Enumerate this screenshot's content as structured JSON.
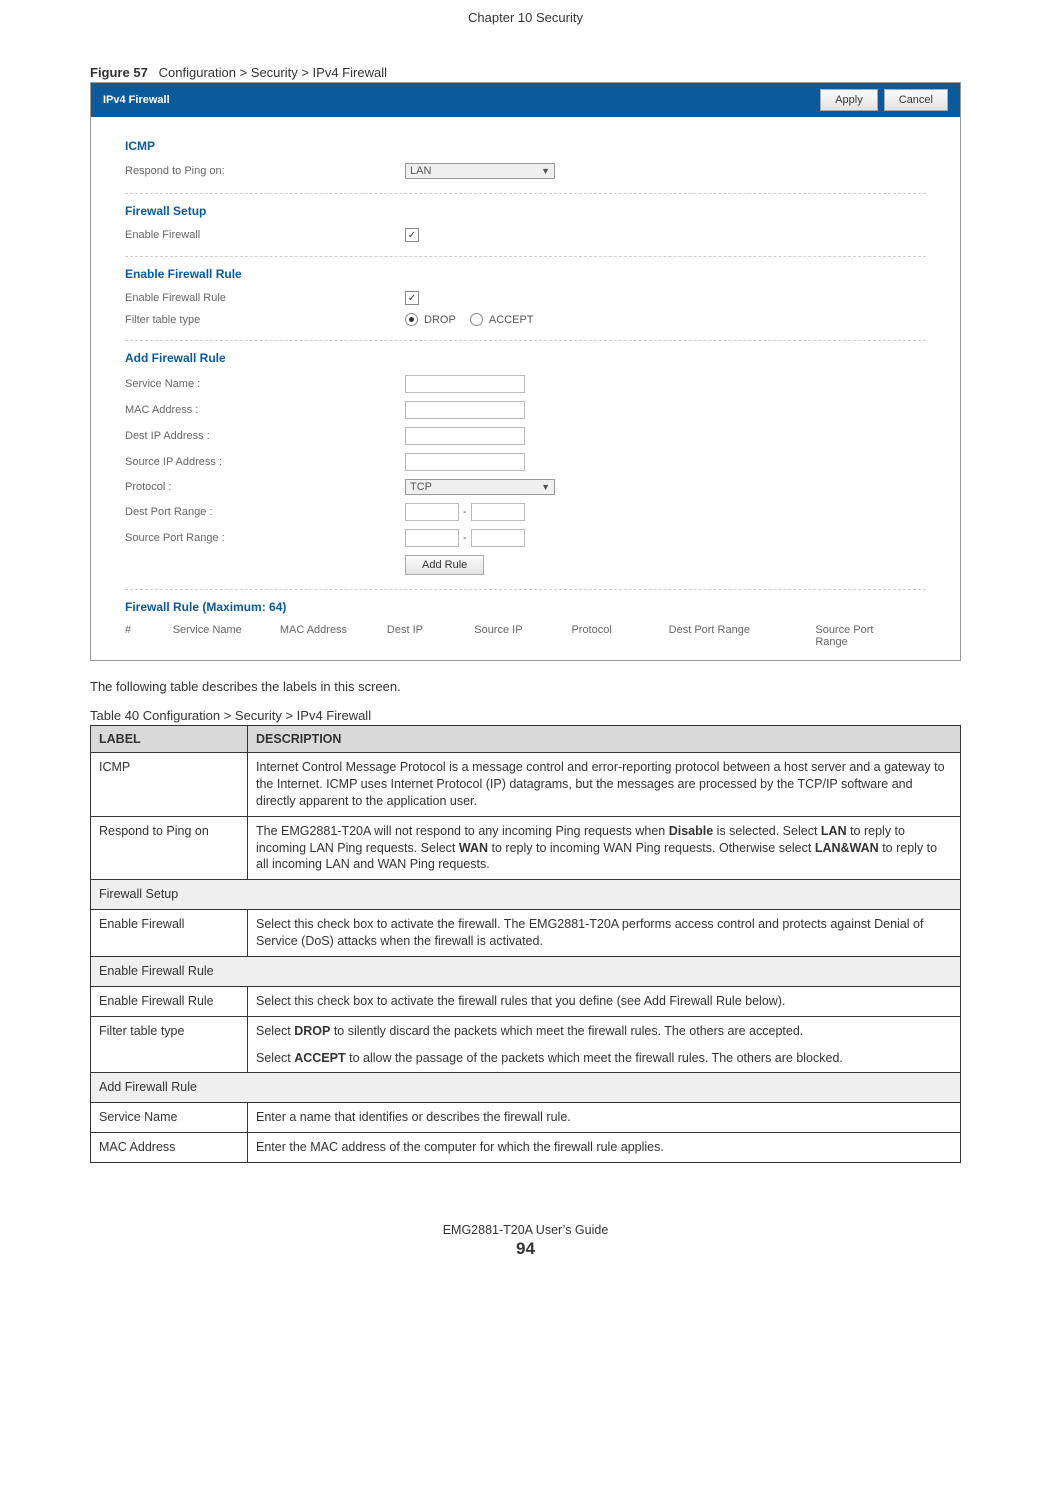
{
  "header": {
    "chapter": "Chapter 10 Security"
  },
  "figure": {
    "label": "Figure 57",
    "caption": "Configuration > Security > IPv4 Firewall"
  },
  "screenshot": {
    "title": "IPv4 Firewall",
    "apply": "Apply",
    "cancel": "Cancel",
    "sections": {
      "icmp": {
        "title": "ICMP",
        "respond_label": "Respond to Ping on:",
        "respond_value": "LAN"
      },
      "fw_setup": {
        "title": "Firewall Setup",
        "enable_label": "Enable Firewall"
      },
      "fw_rule": {
        "title": "Enable Firewall Rule",
        "enable_label": "Enable Firewall Rule",
        "filter_label": "Filter table type",
        "drop": "DROP",
        "accept": "ACCEPT"
      },
      "add_rule": {
        "title": "Add Firewall Rule",
        "service": "Service Name :",
        "mac": "MAC Address :",
        "destip": "Dest IP Address :",
        "srcip": "Source IP Address :",
        "proto_label": "Protocol :",
        "proto_value": "TCP",
        "destport": "Dest Port Range :",
        "srcport": "Source Port Range :",
        "add_btn": "Add Rule"
      },
      "rule_list": {
        "title": "Firewall Rule (Maximum: 64)",
        "cols": {
          "num": "#",
          "service": "Service Name",
          "mac": "MAC Address",
          "destip": "Dest IP",
          "srcip": "Source IP",
          "proto": "Protocol",
          "destport": "Dest Port Range",
          "srcport": "Source Port Range"
        }
      }
    }
  },
  "intro_text": "The following table describes the labels in this screen.",
  "table": {
    "caption": "Table 40   Configuration > Security > IPv4 Firewall",
    "head": {
      "label": "LABEL",
      "desc": "DESCRIPTION"
    },
    "rows": {
      "icmp": {
        "label": "ICMP",
        "desc": "Internet Control Message Protocol is a message control and error-reporting protocol between a host server and a gateway to the Internet. ICMP uses Internet Protocol (IP) datagrams, but the messages are processed by the TCP/IP software and directly apparent to the application user."
      },
      "respond": {
        "label": "Respond to Ping on",
        "p1a": "The EMG2881-T20A will not respond to any incoming Ping requests when ",
        "p1b": "Disable",
        "p1c": " is selected. Select ",
        "p1d": "LAN",
        "p1e": " to reply to incoming LAN Ping requests. Select ",
        "p1f": "WAN",
        "p1g": " to reply to incoming WAN Ping requests. Otherwise select ",
        "p1h": "LAN&WAN",
        "p1i": " to reply to all incoming LAN and WAN Ping requests."
      },
      "fw_setup_section": {
        "label": "Firewall Setup"
      },
      "enable_fw": {
        "label": "Enable Firewall",
        "desc": "Select this check box to activate the firewall. The EMG2881-T20A performs access control and protects against Denial of Service (DoS) attacks when the firewall is activated."
      },
      "fw_rule_section": {
        "label": "Enable Firewall Rule"
      },
      "enable_fw_rule": {
        "label": "Enable Firewall Rule",
        "desc": "Select this check box to activate the firewall rules that you define (see Add Firewall Rule below)."
      },
      "filter_type": {
        "label": "Filter table type",
        "p1a": "Select ",
        "p1b": "DROP",
        "p1c": " to silently discard the packets which meet the firewall rules. The others are accepted.",
        "p2a": "Select ",
        "p2b": "ACCEPT",
        "p2c": " to allow the passage of the packets which meet the firewall rules. The others are blocked."
      },
      "add_rule_section": {
        "label": "Add Firewall Rule"
      },
      "service_name": {
        "label": "Service Name",
        "desc": "Enter a name that identifies or describes the firewall rule."
      },
      "mac_addr": {
        "label": "MAC Address",
        "desc": "Enter the MAC address of the computer for which the firewall rule applies."
      }
    }
  },
  "footer": {
    "guide": "EMG2881-T20A User’s Guide",
    "page": "94"
  }
}
